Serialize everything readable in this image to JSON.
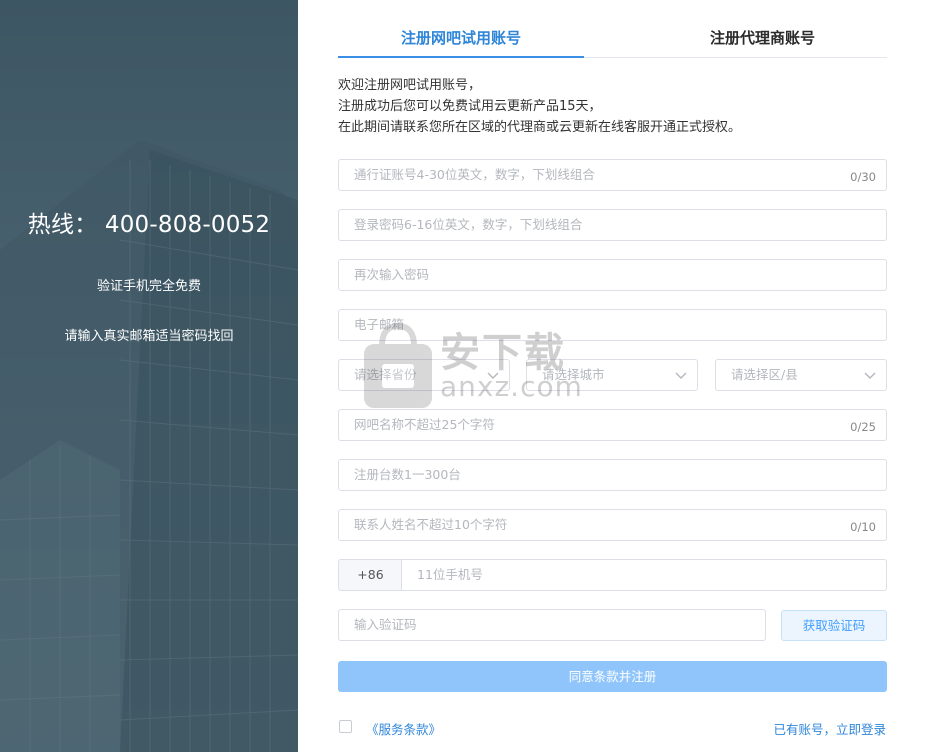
{
  "left_panel": {
    "hotline": "热线： 400-808-0052",
    "line1": "验证手机完全免费",
    "line2": "请输入真实邮箱适当密码找回"
  },
  "tabs": {
    "active": "注册网吧试用账号",
    "inactive": "注册代理商账号"
  },
  "intro": {
    "line1": "欢迎注册网吧试用账号，",
    "line2": "注册成功后您可以免费试用云更新产品15天，",
    "line3": "在此期间请联系您所在区域的代理商或云更新在线客服开通正式授权。"
  },
  "form": {
    "account_placeholder": "通行证账号4-30位英文，数字，下划线组合",
    "account_counter": "0/30",
    "password_placeholder": "登录密码6-16位英文，数字，下划线组合",
    "repeat_password_placeholder": "再次输入密码",
    "email_placeholder": "电子邮箱",
    "province_placeholder": "请选择省份",
    "city_placeholder": "请选择城市",
    "district_placeholder": "请选择区/县",
    "cafe_name_placeholder": "网吧名称不超过25个字符",
    "cafe_name_counter": "0/25",
    "machines_placeholder": "注册台数1一300台",
    "contact_placeholder": "联系人姓名不超过10个字符",
    "contact_counter": "0/10",
    "phone_prefix": "+86",
    "phone_placeholder": "11位手机号",
    "code_placeholder": "输入验证码",
    "get_code_label": "获取验证码",
    "submit_label": "同意条款并注册",
    "terms_label": "《服务条款》",
    "login_label": "已有账号，立即登录"
  },
  "watermark": {
    "title": "安下载",
    "domain": "anxz.com"
  },
  "colors": {
    "accent": "#2f86d9",
    "submit": "#90c5fb",
    "left_panel": "#4a6370"
  }
}
